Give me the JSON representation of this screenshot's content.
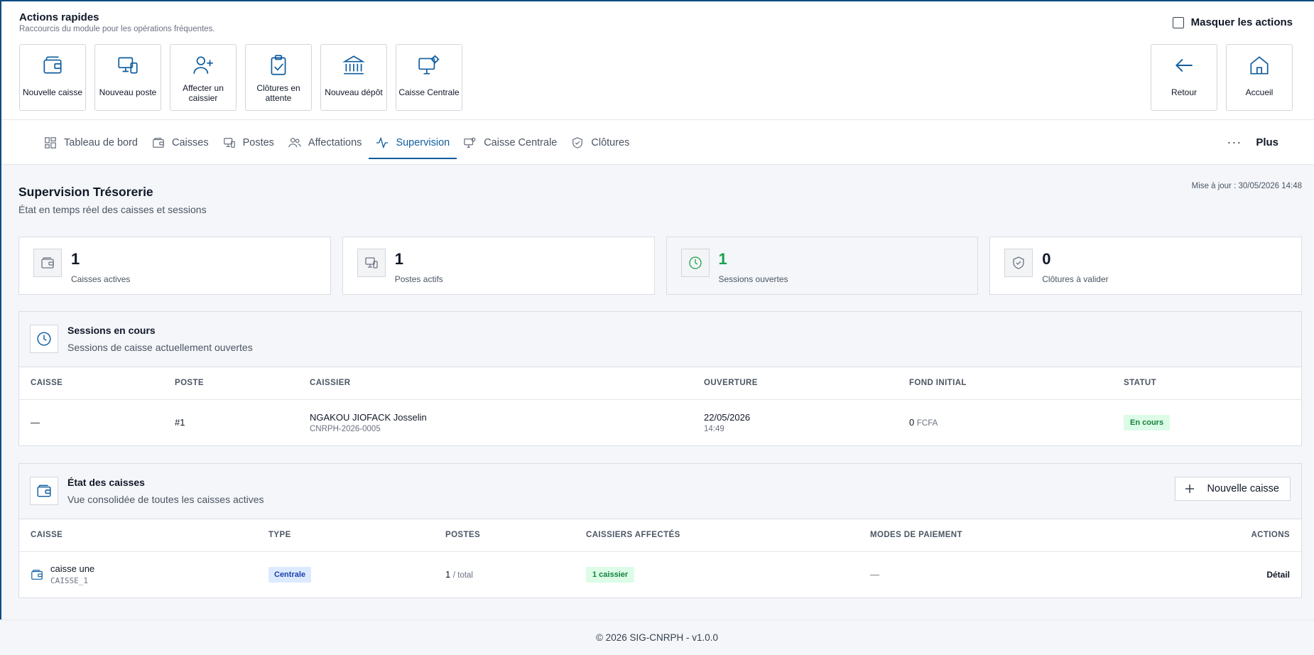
{
  "quick_actions": {
    "title": "Actions rapides",
    "subtitle": "Raccourcis du module pour les opérations fréquentes.",
    "hide_label": "Masquer les actions",
    "tiles": [
      {
        "label": "Nouvelle caisse",
        "icon": "wallet-icon"
      },
      {
        "label": "Nouveau poste",
        "icon": "devices-icon"
      },
      {
        "label": "Affecter un caissier",
        "icon": "user-plus-icon"
      },
      {
        "label": "Clôtures en attente",
        "icon": "clipboard-check-icon"
      },
      {
        "label": "Nouveau dépôt",
        "icon": "bank-icon"
      },
      {
        "label": "Caisse Centrale",
        "icon": "monitor-gear-icon"
      }
    ],
    "right_tiles": [
      {
        "label": "Retour",
        "icon": "arrow-left-icon"
      },
      {
        "label": "Accueil",
        "icon": "home-icon"
      }
    ]
  },
  "tabs": [
    {
      "label": "Tableau de bord",
      "icon": "dashboard-icon"
    },
    {
      "label": "Caisses",
      "icon": "wallet-icon"
    },
    {
      "label": "Postes",
      "icon": "devices-icon"
    },
    {
      "label": "Affectations",
      "icon": "users-icon"
    },
    {
      "label": "Supervision",
      "icon": "activity-icon",
      "active": true
    },
    {
      "label": "Caisse Centrale",
      "icon": "monitor-gear-icon"
    },
    {
      "label": "Clôtures",
      "icon": "shield-check-icon"
    }
  ],
  "more_label": "Plus",
  "page": {
    "title": "Supervision Trésorerie",
    "subtitle": "État en temps réel des caisses et sessions",
    "updated": "Mise à jour : 30/05/2026 14:48"
  },
  "stats": [
    {
      "value": "1",
      "label": "Caisses actives",
      "icon": "wallet-icon"
    },
    {
      "value": "1",
      "label": "Postes actifs",
      "icon": "devices-icon"
    },
    {
      "value": "1",
      "label": "Sessions ouvertes",
      "icon": "clock-icon",
      "color": "#16a34a"
    },
    {
      "value": "0",
      "label": "Clôtures à valider",
      "icon": "shield-check-icon"
    }
  ],
  "sessions": {
    "title": "Sessions en cours",
    "subtitle": "Sessions de caisse actuellement ouvertes",
    "columns": [
      "CAISSE",
      "POSTE",
      "CAISSIER",
      "OUVERTURE",
      "FOND INITIAL",
      "STATUT"
    ],
    "rows": [
      {
        "caisse": "—",
        "poste": "#1",
        "caissier": "NGAKOU JIOFACK Josselin",
        "caissier_code": "CNRPH-2026-0005",
        "ouverture_date": "22/05/2026",
        "ouverture_time": "14:49",
        "fond": "0",
        "currency": "FCFA",
        "statut": "En cours"
      }
    ]
  },
  "caisses": {
    "title": "État des caisses",
    "subtitle": "Vue consolidée de toutes les caisses actives",
    "new_button": "Nouvelle caisse",
    "columns": [
      "CAISSE",
      "TYPE",
      "POSTES",
      "CAISSIERS AFFECTÉS",
      "MODES DE PAIEMENT",
      "ACTIONS"
    ],
    "rows": [
      {
        "name": "caisse une",
        "code": "CAISSE_1",
        "type": "Centrale",
        "postes": "1",
        "postes_suffix": "/ total",
        "caissiers": "1 caissier",
        "modes": "—",
        "action": "Détail"
      }
    ]
  },
  "footer": "© 2026 SIG-CNRPH - v1.0.0",
  "colors": {
    "accent": "#0f5c9e",
    "success": "#16a34a",
    "border": "#d9dde3"
  }
}
